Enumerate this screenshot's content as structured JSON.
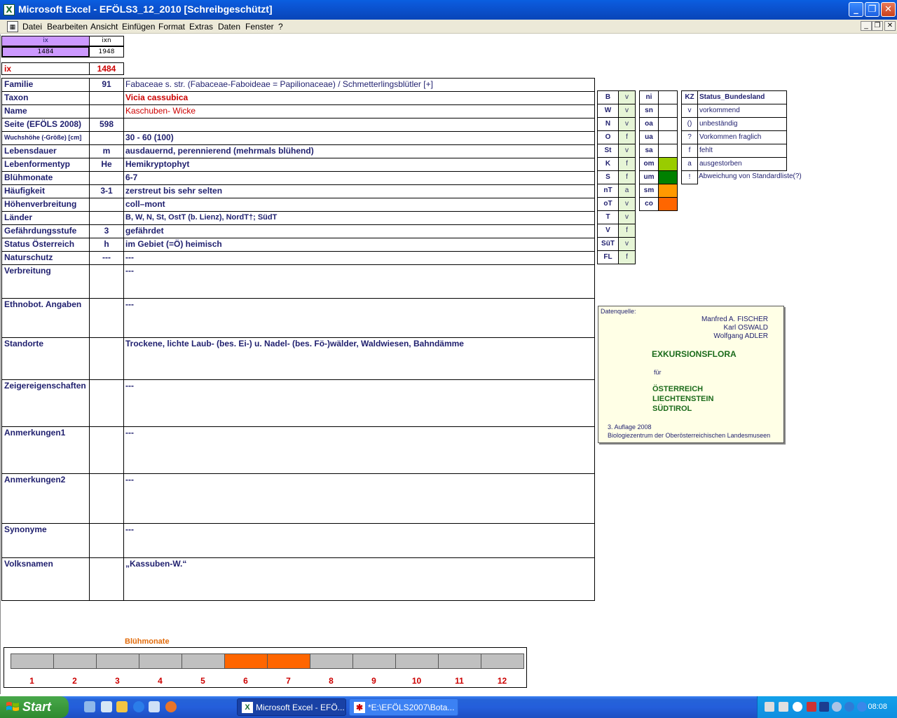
{
  "window": {
    "title": "Microsoft Excel - EFÖLS3_12_2010  [Schreibgeschützt]",
    "app_icon": "X",
    "buttons": {
      "minimize": "_",
      "restore": "❐",
      "close": "✕"
    }
  },
  "menu": {
    "items": [
      "Datei",
      "Bearbeiten",
      "Ansicht",
      "Einfügen",
      "Format",
      "Extras",
      "Daten",
      "Fenster",
      "?"
    ],
    "mdi_buttons": {
      "minimize": "_",
      "restore": "❐",
      "close": "✕"
    }
  },
  "index_box": {
    "hdr_ix": "ix",
    "hdr_ixn": "ixn",
    "val_ix": "1484",
    "val_ixn": "1948",
    "ix_label": "ix",
    "ix_value": "1484"
  },
  "rows": [
    {
      "label": "Familie",
      "num": "91",
      "value": "Fabaceae s. str. (Fabaceae-Faboideae = Papilionaceae)  /  Schmetterlingsblütler [+]",
      "style": "normal"
    },
    {
      "label": "Taxon",
      "num": "",
      "value": "Vicia cassubica",
      "style": "red-bold"
    },
    {
      "label": "Name",
      "num": "",
      "value": "Kaschuben- Wicke",
      "style": "red"
    },
    {
      "label": "Seite (EFÖLS 2008)",
      "num": "598",
      "value": "",
      "style": "bold"
    },
    {
      "label": "Wuchshöhe (-Größe) [cm]",
      "num": "",
      "value": " 30 - 60 (100)",
      "style": "bold"
    },
    {
      "label": "Lebensdauer",
      "num": "m",
      "value": "ausdauernd, perennierend (mehrmals blühend)",
      "style": "bold"
    },
    {
      "label": "Lebenformentyp",
      "num": "He",
      "value": "Hemikryptophyt",
      "style": "bold"
    },
    {
      "label": "Blühmonate",
      "num": "",
      "value": " 6-7",
      "style": "bold"
    },
    {
      "label": "Häufigkeit",
      "num": "3-1",
      "value": "zerstreut bis sehr selten",
      "style": "bold"
    },
    {
      "label": "Höhenverbreitung",
      "num": "",
      "value": "coll–mont",
      "style": "bold"
    },
    {
      "label": "Länder",
      "num": "",
      "value": "B, W, N, St, OstT (b. Lienz), NordT†; SüdT",
      "style": "bold-small"
    },
    {
      "label": "Gefährdungsstufe",
      "num": "3",
      "value": "gefährdet",
      "style": "bold"
    },
    {
      "label": "Status Österreich",
      "num": "h",
      "value": "im Gebiet (=Ö) heimisch",
      "style": "bold"
    },
    {
      "label": "Naturschutz",
      "num": "---",
      "value": "---",
      "style": "bold"
    }
  ],
  "tall_rows": [
    {
      "label": "Verbreitung",
      "value": "---",
      "style": "bold"
    },
    {
      "label": "Ethnobot. Angaben",
      "value": "---",
      "style": "bold"
    },
    {
      "label": "Standorte",
      "value": "Trockene, lichte Laub- (bes. Ei-) u. Nadel- (bes. Fö-)wälder, Waldwiesen, Bahndämme",
      "style": "bold"
    },
    {
      "label": "Zeigereigenschaften",
      "value": "---",
      "style": "bold"
    },
    {
      "label": "Anmerkungen1",
      "value": "---",
      "style": "bold"
    },
    {
      "label": "Anmerkungen2",
      "value": "---",
      "style": "bold"
    },
    {
      "label": "Synonyme",
      "value": "---",
      "style": "bold"
    },
    {
      "label": "Volksnamen",
      "value": "„Kassuben-W.“",
      "style": "bold"
    }
  ],
  "bundesland": [
    {
      "kz": "B",
      "v": "v"
    },
    {
      "kz": "W",
      "v": "v"
    },
    {
      "kz": "N",
      "v": "v"
    },
    {
      "kz": "O",
      "v": "f"
    },
    {
      "kz": "St",
      "v": "v"
    },
    {
      "kz": "K",
      "v": "f"
    },
    {
      "kz": "S",
      "v": "f"
    },
    {
      "kz": "nT",
      "v": "a"
    },
    {
      "kz": "oT",
      "v": "v"
    },
    {
      "kz": "T",
      "v": "v"
    },
    {
      "kz": "V",
      "v": "f"
    },
    {
      "kz": "SüT",
      "v": "v"
    },
    {
      "kz": "FL",
      "v": "f"
    }
  ],
  "hoehen": [
    {
      "code": "ni",
      "color": ""
    },
    {
      "code": "sn",
      "color": ""
    },
    {
      "code": "oa",
      "color": ""
    },
    {
      "code": "ua",
      "color": ""
    },
    {
      "code": "sa",
      "color": ""
    },
    {
      "code": "om",
      "color": "#99cc00"
    },
    {
      "code": "um",
      "color": "#008000"
    },
    {
      "code": "sm",
      "color": "#ff9900"
    },
    {
      "code": "co",
      "color": "#ff6600"
    }
  ],
  "status_legend": {
    "header_kz": "KZ",
    "header_text": "Status_Bundesland",
    "items": [
      {
        "kz": "v",
        "text": "vorkommend"
      },
      {
        "kz": "()",
        "text": "unbeständig"
      },
      {
        "kz": "?",
        "text": "Vorkommen fraglich"
      },
      {
        "kz": "f",
        "text": "fehlt"
      },
      {
        "kz": "a",
        "text": "ausgestorben"
      },
      {
        "kz": "!",
        "text": "Abweichung von Standardliste(?)"
      }
    ]
  },
  "datenquelle": {
    "label": "Datenquelle:",
    "authors": [
      "Manfred A. FISCHER",
      "Karl OSWALD",
      "Wolfgang ADLER"
    ],
    "title": "EXKURSIONSFLORA",
    "fuer": "für",
    "countries": [
      "ÖSTERREICH",
      "LIECHTENSTEIN",
      "SÜDTIROL"
    ],
    "edition": "3. Auflage 2008",
    "publisher": "Biologiezentrum der Oberösterreichischen Landesmuseen"
  },
  "bluehmonate": {
    "title": "Blühmonate",
    "months": [
      "1",
      "2",
      "3",
      "4",
      "5",
      "6",
      "7",
      "8",
      "9",
      "10",
      "11",
      "12"
    ],
    "active": [
      6,
      7
    ],
    "active_color": "#ff6600",
    "inactive_color": "#c0c0c0"
  },
  "taskbar": {
    "start": "Start",
    "tasks": [
      {
        "label": "Microsoft Excel - EFÖ...",
        "active": true
      },
      {
        "label": "*E:\\EFÖLS2007\\Bota...",
        "active": false
      }
    ],
    "clock": "08:08"
  }
}
